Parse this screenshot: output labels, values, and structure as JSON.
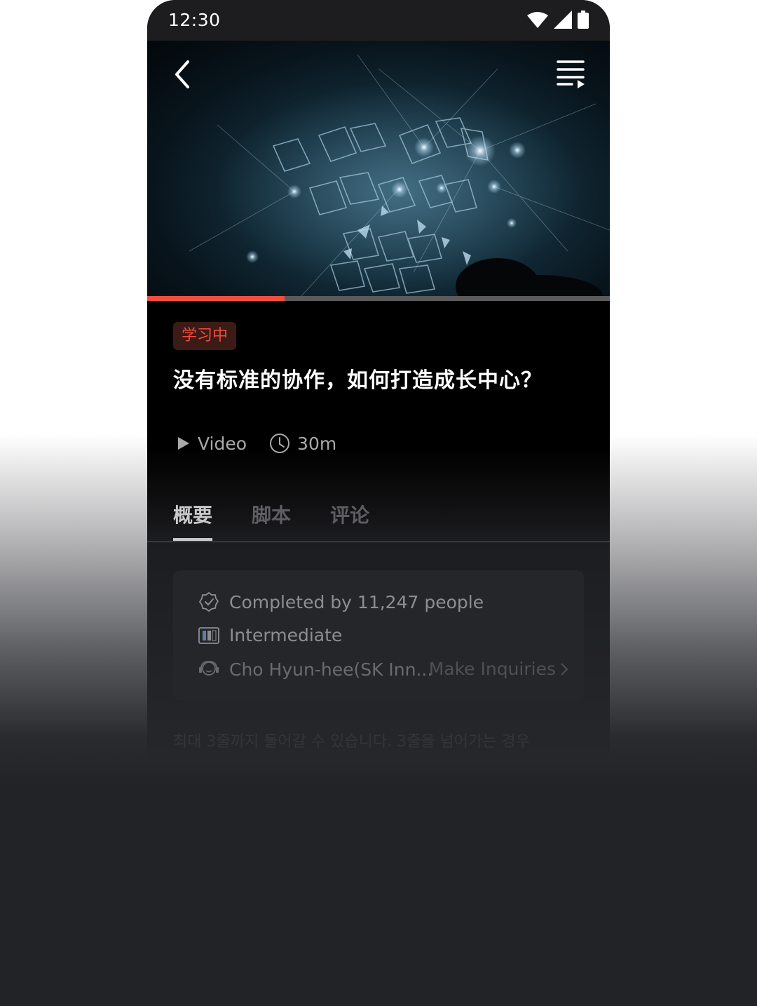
{
  "status_bar": {
    "time": "12:30",
    "icons": [
      "wifi-icon",
      "signal-icon",
      "battery-icon"
    ]
  },
  "player": {
    "back_icon": "chevron-left-icon",
    "playlist_icon": "playlist-icon",
    "progress": 0.297
  },
  "course": {
    "badge": "学习中",
    "title": "没有标准的协作，如何打造成长中心？",
    "type_label": "Video",
    "duration": "30m"
  },
  "tabs": [
    {
      "label": "概要",
      "active": true
    },
    {
      "label": "脚本",
      "active": false
    },
    {
      "label": "评论",
      "active": false
    }
  ],
  "info_card": {
    "completed": "Completed by 11,247 people",
    "level": "Intermediate",
    "instructor": "Cho Hyun-hee(SK Inn...",
    "inquiry": "Make Inquiries"
  },
  "description": "최대 3줄까지 들어갈 수 있습니다. 3줄을 넘어가는 경우",
  "colors": {
    "accent": "#f04e3e",
    "background": "#000000"
  }
}
